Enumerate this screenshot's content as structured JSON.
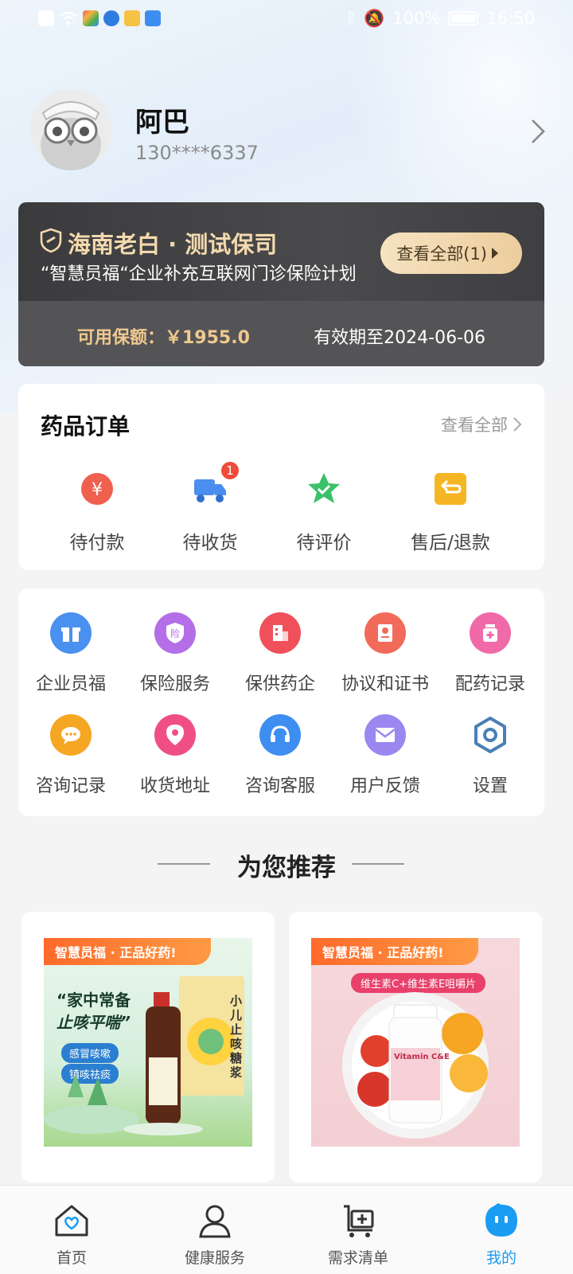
{
  "status_bar": {
    "battery_percent": "100%",
    "time": "16:50"
  },
  "profile": {
    "name": "阿巴",
    "phone": "130****6337"
  },
  "insurance": {
    "title": "海南老白 · 测试保司",
    "subtitle": "“智慧员福“企业补充互联网门诊保险计划",
    "view_all": "查看全部(1)",
    "quota": "可用保额：￥1955.0",
    "expire": "有效期至2024-06-06"
  },
  "orders": {
    "title": "药品订单",
    "view_all": "查看全部",
    "items": [
      {
        "label": "待付款",
        "icon": "yen-icon"
      },
      {
        "label": "待收货",
        "icon": "truck-icon",
        "badge": "1"
      },
      {
        "label": "待评价",
        "icon": "star-icon"
      },
      {
        "label": "售后/退款",
        "icon": "return-icon"
      }
    ]
  },
  "services": [
    {
      "label": "企业员福",
      "icon": "gift-icon",
      "color": "#4a90f0"
    },
    {
      "label": "保险服务",
      "icon": "insurance-shield-icon",
      "color": "#b36ee8"
    },
    {
      "label": "保供药企",
      "icon": "building-icon",
      "color": "#f0505a"
    },
    {
      "label": "协议和证书",
      "icon": "certificate-icon",
      "color": "#f26b5a"
    },
    {
      "label": "配药记录",
      "icon": "medicine-bottle-icon",
      "color": "#f06aa8"
    },
    {
      "label": "咨询记录",
      "icon": "chat-icon",
      "color": "#f5a623"
    },
    {
      "label": "收货地址",
      "icon": "location-icon",
      "color": "#f04f86"
    },
    {
      "label": "咨询客服",
      "icon": "headset-icon",
      "color": "#3d8ef0"
    },
    {
      "label": "用户反馈",
      "icon": "mail-icon",
      "color": "#9b87f0"
    },
    {
      "label": "设置",
      "icon": "settings-icon",
      "color": "#4a7fb5"
    }
  ],
  "recommend": {
    "title": "为您推荐",
    "products": [
      {
        "banner": "智慧员福 · 正品好药!",
        "slogan1": "“家中常备",
        "slogan2": "止咳平喘”",
        "tag1": "感冒咳嗽",
        "tag2": "镇咳祛痰",
        "box_text": "小儿止咳糖浆"
      },
      {
        "banner": "智慧员福 · 正品好药!",
        "tag": "维生素C+维生素E咀嚼片",
        "bottle_text": "Vitamin C&E"
      }
    ]
  },
  "bottom_nav": [
    {
      "label": "首页",
      "icon": "home-heart-icon"
    },
    {
      "label": "健康服务",
      "icon": "health-person-icon"
    },
    {
      "label": "需求清单",
      "icon": "cart-plus-icon"
    },
    {
      "label": "我的",
      "icon": "mine-face-icon",
      "active": true
    }
  ],
  "colors": {
    "accent": "#1a9cf3",
    "gold": "#f3d9ae",
    "card_dark": "#3f3f41"
  }
}
